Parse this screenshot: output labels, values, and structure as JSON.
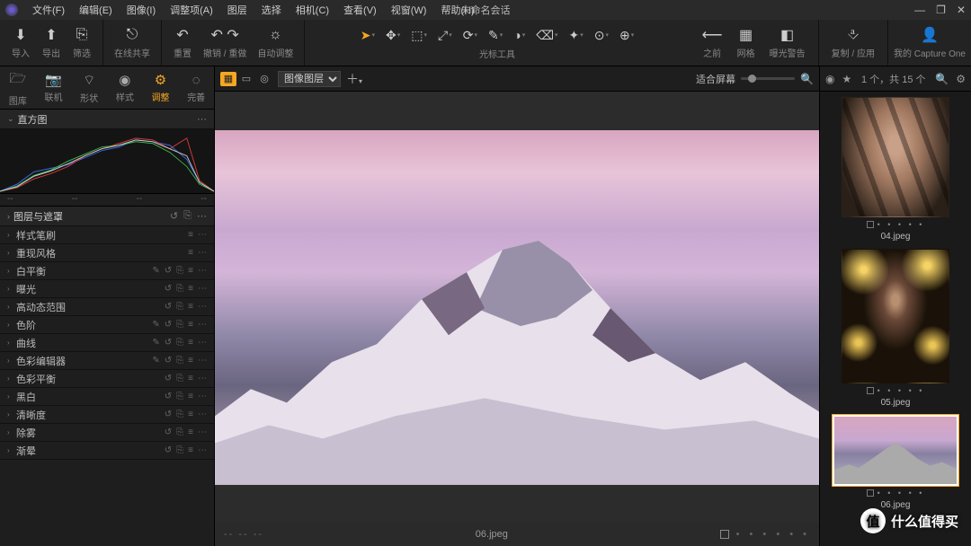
{
  "window": {
    "title": "未命名会话"
  },
  "menubar": [
    "文件(F)",
    "编辑(E)",
    "图像(I)",
    "调整项(A)",
    "图层",
    "选择",
    "相机(C)",
    "查看(V)",
    "视窗(W)",
    "帮助(H)"
  ],
  "winctrl": {
    "min": "—",
    "max": "❐",
    "close": "✕"
  },
  "toolbar": {
    "left": [
      {
        "icon": "⬇",
        "label": "导入"
      },
      {
        "icon": "⬆",
        "label": "导出"
      },
      {
        "icon": "⎘",
        "label": "筛选"
      }
    ],
    "share": {
      "icon": "⎋",
      "label": "在线共享"
    },
    "history": [
      {
        "icon": "↶",
        "label": "重置"
      },
      {
        "icon": "↶ ↷",
        "label": "撤销 / 重做"
      },
      {
        "icon": "☼",
        "label": "自动调整"
      }
    ],
    "cursor": {
      "tools": [
        "➤",
        "✥",
        "⬚",
        "⤢",
        "⟳",
        "✎",
        "◑",
        "⌫",
        "✦",
        "⊙",
        "⊕"
      ],
      "label": "光标工具"
    },
    "nav": [
      {
        "icon": "⟵",
        "label": "之前"
      },
      {
        "icon": "▦",
        "label": "网格"
      },
      {
        "icon": "◧",
        "label": "曝光警告"
      }
    ],
    "apply": {
      "icon": "⎀",
      "label": "复制 / 应用"
    },
    "account": {
      "icon": "👤",
      "label": "我的 Capture One"
    }
  },
  "tooltabs": [
    {
      "icon": "🗁",
      "label": "图库"
    },
    {
      "icon": "📷",
      "label": "联机"
    },
    {
      "icon": "⌔",
      "label": "形状"
    },
    {
      "icon": "◉",
      "label": "样式"
    },
    {
      "icon": "⚙",
      "label": "调整"
    },
    {
      "icon": "◌",
      "label": "完善"
    }
  ],
  "histogram_title": "直方图",
  "histo_footer": {
    "l1": "--",
    "l2": "--",
    "r1": "--",
    "r2": "--"
  },
  "layers_title": "图层与遮罩",
  "tools": [
    {
      "name": "样式笔刷",
      "ctrls": [
        "≡",
        "⋯"
      ]
    },
    {
      "name": "重现风格",
      "ctrls": [
        "≡",
        "⋯"
      ]
    },
    {
      "name": "白平衡",
      "ctrls": [
        "✎",
        "↺",
        "⎘",
        "≡",
        "⋯"
      ]
    },
    {
      "name": "曝光",
      "ctrls": [
        "↺",
        "⎘",
        "≡",
        "⋯"
      ]
    },
    {
      "name": "高动态范围",
      "ctrls": [
        "↺",
        "⎘",
        "≡",
        "⋯"
      ]
    },
    {
      "name": "色阶",
      "ctrls": [
        "✎",
        "↺",
        "⎘",
        "≡",
        "⋯"
      ]
    },
    {
      "name": "曲线",
      "ctrls": [
        "✎",
        "↺",
        "⎘",
        "≡",
        "⋯"
      ]
    },
    {
      "name": "色彩编辑器",
      "ctrls": [
        "✎",
        "↺",
        "⎘",
        "≡",
        "⋯"
      ]
    },
    {
      "name": "色彩平衡",
      "ctrls": [
        "↺",
        "⎘",
        "≡",
        "⋯"
      ]
    },
    {
      "name": "黑白",
      "ctrls": [
        "↺",
        "⎘",
        "≡",
        "⋯"
      ]
    },
    {
      "name": "清晰度",
      "ctrls": [
        "↺",
        "⎘",
        "≡",
        "⋯"
      ]
    },
    {
      "name": "除雾",
      "ctrls": [
        "↺",
        "⎘",
        "≡",
        "⋯"
      ]
    },
    {
      "name": "渐晕",
      "ctrls": [
        "↺",
        "⎘",
        "≡",
        "⋯"
      ]
    }
  ],
  "viewer": {
    "layer_select": "图像图层",
    "fit_label": "适合屏幕",
    "filename": "06.jpeg",
    "dashes": "--  --  --"
  },
  "browser": {
    "count_label": "1 个，共 15 个",
    "thumbs": [
      {
        "name": "04.jpeg",
        "cls": "face1 partial-top"
      },
      {
        "name": "05.jpeg",
        "cls": "face2"
      },
      {
        "name": "06.jpeg",
        "cls": "mount-thumb landscape",
        "selected": true
      }
    ]
  },
  "watermark": {
    "badge": "值",
    "text": "什么值得买"
  }
}
